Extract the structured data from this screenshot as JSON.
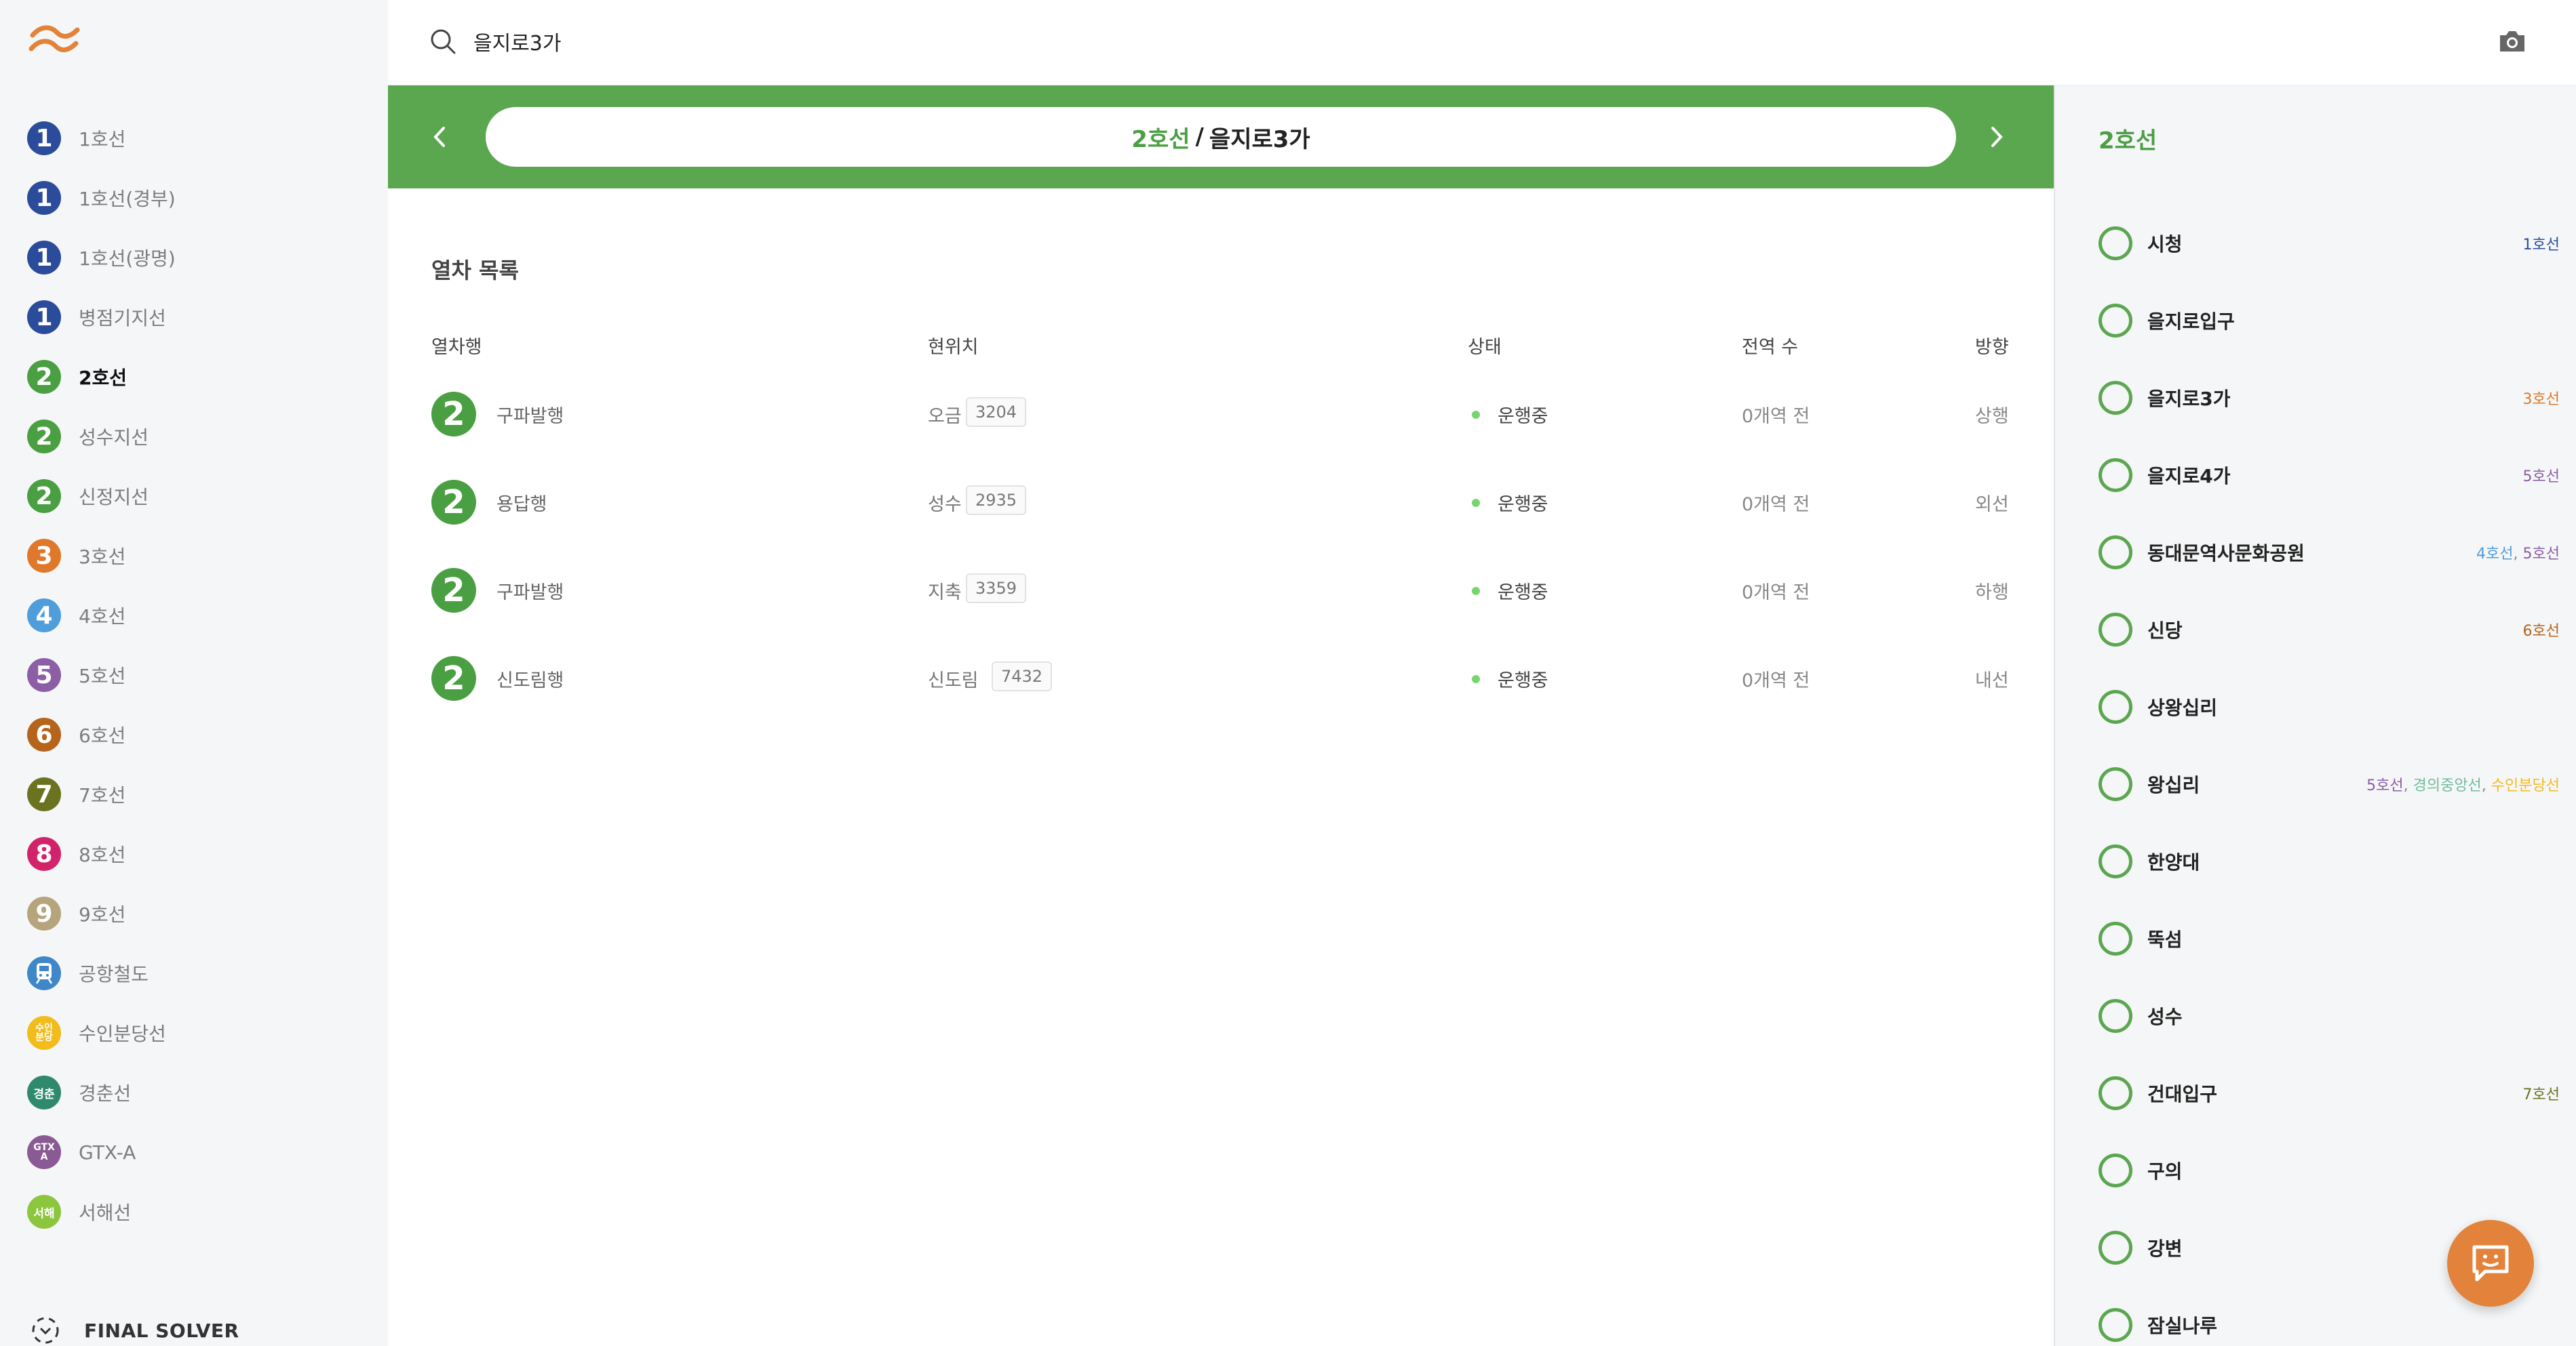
{
  "search": {
    "value": "을지로3가"
  },
  "sidebar": {
    "lines": [
      {
        "badge": "1",
        "label": "1호선",
        "color": "#2a4c9a"
      },
      {
        "badge": "1",
        "label": "1호선(경부)",
        "color": "#2a4c9a"
      },
      {
        "badge": "1",
        "label": "1호선(광명)",
        "color": "#2a4c9a"
      },
      {
        "badge": "1",
        "label": "병점기지선",
        "color": "#2a4c9a"
      },
      {
        "badge": "2",
        "label": "2호선",
        "color": "#4a9f42",
        "active": true
      },
      {
        "badge": "2",
        "label": "성수지선",
        "color": "#4a9f42"
      },
      {
        "badge": "2",
        "label": "신정지선",
        "color": "#4a9f42"
      },
      {
        "badge": "3",
        "label": "3호선",
        "color": "#e0782b"
      },
      {
        "badge": "4",
        "label": "4호선",
        "color": "#4f9ddb"
      },
      {
        "badge": "5",
        "label": "5호선",
        "color": "#8b5ea6"
      },
      {
        "badge": "6",
        "label": "6호선",
        "color": "#b5641c"
      },
      {
        "badge": "7",
        "label": "7호선",
        "color": "#6b7321"
      },
      {
        "badge": "8",
        "label": "8호선",
        "color": "#d1226a"
      },
      {
        "badge": "9",
        "label": "9호선",
        "color": "#b5a47c"
      },
      {
        "badge": "",
        "label": "공항철도",
        "color": "#3f87c9",
        "icon": "train-icon"
      },
      {
        "badge": "수인\n분당",
        "label": "수인분당선",
        "color": "#f2bc1b"
      },
      {
        "badge": "경춘",
        "label": "경춘선",
        "color": "#2f8a6d"
      },
      {
        "badge": "GTX\nA",
        "label": "GTX-A",
        "color": "#8a5a94"
      },
      {
        "badge": "서해",
        "label": "서해선",
        "color": "#8cc63f"
      }
    ],
    "brand": "FINAL SOLVER"
  },
  "header": {
    "line": "2호선",
    "separator": "/",
    "station": "을지로3가"
  },
  "trains": {
    "title": "열차 목록",
    "columns": {
      "dest": "열차행",
      "location": "현위치",
      "status": "상태",
      "prev": "전역 수",
      "dir": "방향"
    },
    "rows": [
      {
        "badge": "2",
        "dest": "구파발행",
        "location": "오금",
        "car": "3204",
        "status": "운행중",
        "prev": "0개역 전",
        "dir": "상행"
      },
      {
        "badge": "2",
        "dest": "용답행",
        "location": "성수",
        "car": "2935",
        "status": "운행중",
        "prev": "0개역 전",
        "dir": "외선"
      },
      {
        "badge": "2",
        "dest": "구파발행",
        "location": "지축",
        "car": "3359",
        "status": "운행중",
        "prev": "0개역 전",
        "dir": "하행"
      },
      {
        "badge": "2",
        "dest": "신도림행",
        "location": "신도림",
        "car": "7432",
        "status": "운행중",
        "prev": "0개역 전",
        "dir": "내선"
      }
    ]
  },
  "panel": {
    "title": "2호선",
    "stations": [
      {
        "name": "시청",
        "transfers": [
          {
            "label": "1호선",
            "color": "#2a4c9a"
          }
        ]
      },
      {
        "name": "을지로입구",
        "transfers": []
      },
      {
        "name": "을지로3가",
        "transfers": [
          {
            "label": "3호선",
            "color": "#e0782b"
          }
        ]
      },
      {
        "name": "을지로4가",
        "transfers": [
          {
            "label": "5호선",
            "color": "#8b5ea6"
          }
        ]
      },
      {
        "name": "동대문역사문화공원",
        "transfers": [
          {
            "label": "4호선",
            "color": "#4f9ddb"
          },
          {
            "label": "5호선",
            "color": "#8b5ea6"
          }
        ]
      },
      {
        "name": "신당",
        "transfers": [
          {
            "label": "6호선",
            "color": "#b5641c"
          }
        ]
      },
      {
        "name": "상왕십리",
        "transfers": []
      },
      {
        "name": "왕십리",
        "transfers": [
          {
            "label": "5호선",
            "color": "#8b5ea6"
          },
          {
            "label": "경의중앙선",
            "color": "#6fbf9f"
          },
          {
            "label": "수인분당선",
            "color": "#f2bc1b"
          }
        ]
      },
      {
        "name": "한양대",
        "transfers": []
      },
      {
        "name": "뚝섬",
        "transfers": []
      },
      {
        "name": "성수",
        "transfers": []
      },
      {
        "name": "건대입구",
        "transfers": [
          {
            "label": "7호선",
            "color": "#6b7321"
          }
        ]
      },
      {
        "name": "구의",
        "transfers": []
      },
      {
        "name": "강변",
        "transfers": []
      },
      {
        "name": "잠실나루",
        "transfers": []
      }
    ]
  }
}
